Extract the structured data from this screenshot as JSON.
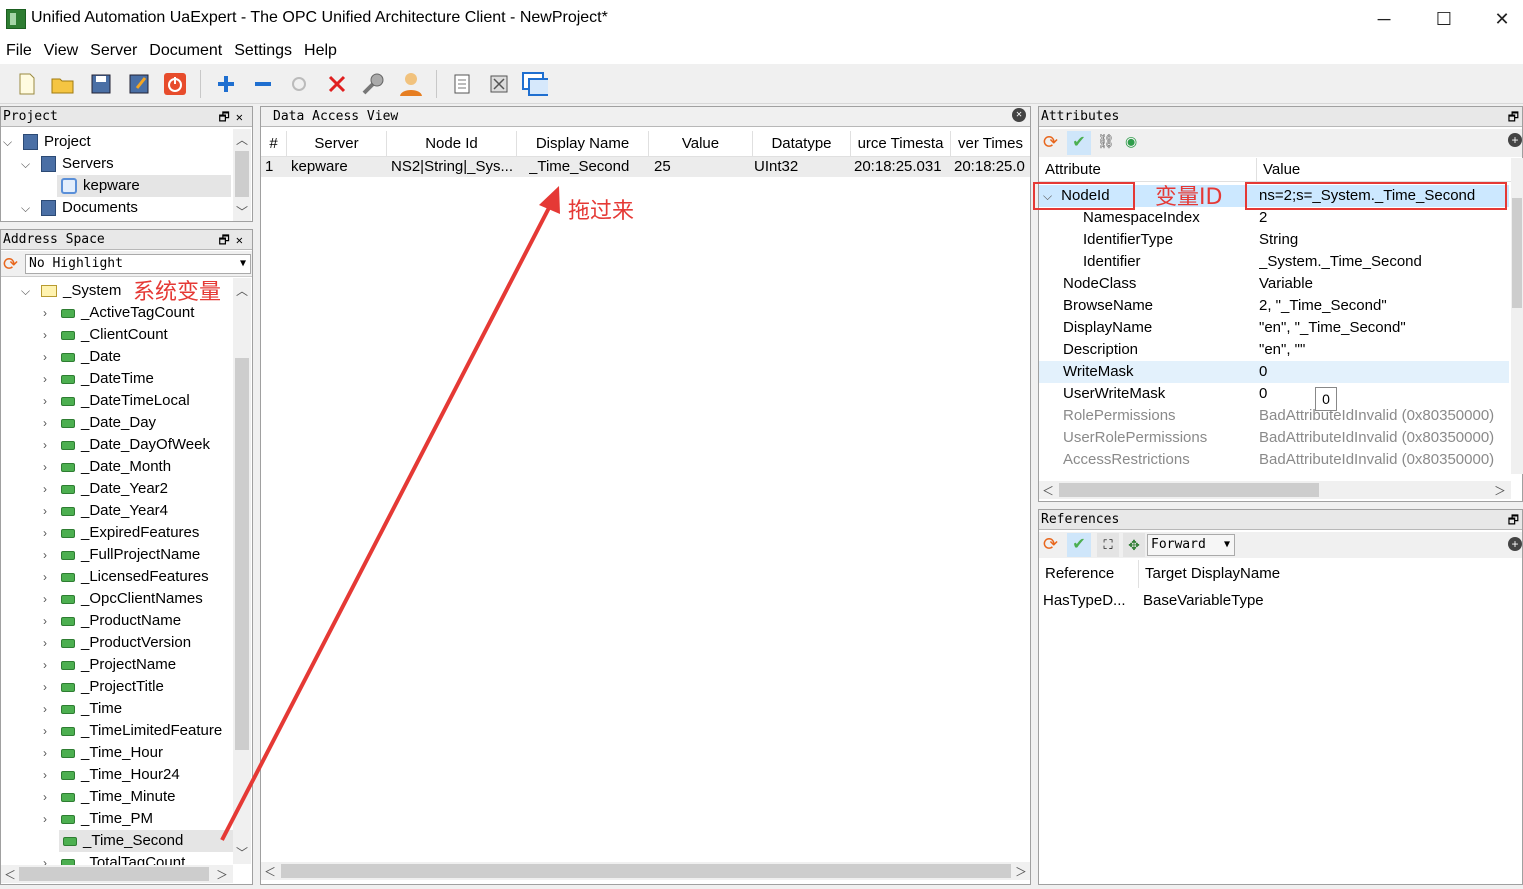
{
  "window": {
    "title": "Unified Automation UaExpert - The OPC Unified Architecture Client - NewProject*",
    "minimize": "─",
    "maximize": "☐",
    "close": "✕"
  },
  "menu": [
    "File",
    "View",
    "Server",
    "Document",
    "Settings",
    "Help"
  ],
  "project_panel": {
    "title": "Project",
    "tree": [
      {
        "label": "Project",
        "level": 0
      },
      {
        "label": "Servers",
        "level": 1
      },
      {
        "label": "kepware",
        "level": 2
      },
      {
        "label": "Documents",
        "level": 1
      }
    ]
  },
  "address_panel": {
    "title": "Address Space",
    "highlight": "No Highlight",
    "root": "_System",
    "items": [
      "_ActiveTagCount",
      "_ClientCount",
      "_Date",
      "_DateTime",
      "_DateTimeLocal",
      "_Date_Day",
      "_Date_DayOfWeek",
      "_Date_Month",
      "_Date_Year2",
      "_Date_Year4",
      "_ExpiredFeatures",
      "_FullProjectName",
      "_LicensedFeatures",
      "_OpcClientNames",
      "_ProductName",
      "_ProductVersion",
      "_ProjectName",
      "_ProjectTitle",
      "_Time",
      "_TimeLimitedFeature",
      "_Time_Hour",
      "_Time_Hour24",
      "_Time_Minute",
      "_Time_PM",
      "_Time_Second",
      "_TotalTagCount"
    ]
  },
  "dav_panel": {
    "title": "Data Access View",
    "columns": [
      "#",
      "Server",
      "Node Id",
      "Display Name",
      "Value",
      "Datatype",
      "urce Timesta",
      "ver Times"
    ],
    "rows": [
      [
        "1",
        "kepware",
        "NS2|String|_Sys...",
        "_Time_Second",
        "25",
        "UInt32",
        "20:18:25.031",
        "20:18:25.0"
      ]
    ]
  },
  "attributes_panel": {
    "title": "Attributes",
    "columns": [
      "Attribute",
      "Value"
    ],
    "rows": [
      {
        "k": "NodeId",
        "v": "ns=2;s=_System._Time_Second",
        "indent": 0,
        "expand": true
      },
      {
        "k": "NamespaceIndex",
        "v": "2",
        "indent": 2
      },
      {
        "k": "IdentifierType",
        "v": "String",
        "indent": 2
      },
      {
        "k": "Identifier",
        "v": "_System._Time_Second",
        "indent": 2
      },
      {
        "k": "NodeClass",
        "v": "Variable",
        "indent": 1
      },
      {
        "k": "BrowseName",
        "v": "2, \"_Time_Second\"",
        "indent": 1
      },
      {
        "k": "DisplayName",
        "v": "\"en\", \"_Time_Second\"",
        "indent": 1
      },
      {
        "k": "Description",
        "v": "\"en\", \"\"",
        "indent": 1
      },
      {
        "k": "WriteMask",
        "v": "0",
        "indent": 1
      },
      {
        "k": "UserWriteMask",
        "v": "0",
        "indent": 1
      },
      {
        "k": "RolePermissions",
        "v": "BadAttributeIdInvalid (0x80350000)",
        "indent": 1,
        "grey": true
      },
      {
        "k": "UserRolePermissions",
        "v": "BadAttributeIdInvalid (0x80350000)",
        "indent": 1,
        "grey": true
      },
      {
        "k": "AccessRestrictions",
        "v": "BadAttributeIdInvalid (0x80350000)",
        "indent": 1,
        "grey": true
      }
    ],
    "tooltip": "0"
  },
  "references_panel": {
    "title": "References",
    "direction": "Forward",
    "columns": [
      "Reference",
      "Target DisplayName"
    ],
    "rows": [
      [
        "HasTypeD...",
        "BaseVariableType"
      ]
    ]
  },
  "annotations": {
    "system_var": "系统变量",
    "var_id": "变量ID",
    "drag_here": "拖过来"
  },
  "colors": {
    "annotation": "#e53935",
    "selection": "#cce8ff"
  }
}
